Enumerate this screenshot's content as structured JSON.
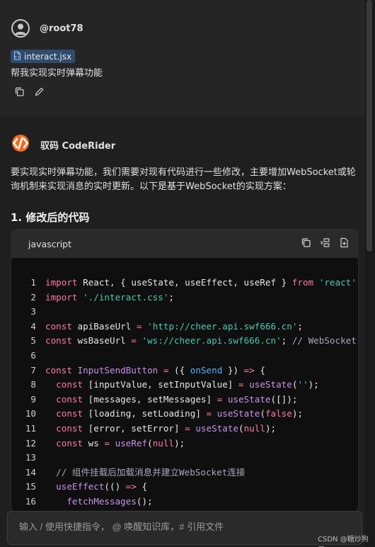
{
  "user_message": {
    "username": "@root78",
    "file_chip": "interact.jsx",
    "text": "帮我实现实时弹幕功能",
    "actions": [
      "copy-icon",
      "edit-icon"
    ]
  },
  "assistant": {
    "name": "驭码 CodeRider",
    "intro": "要实现实时弹幕功能，我们需要对现有代码进行一些修改，主要增加WebSocket或轮询机制来实现消息的实时更新。以下是基于WebSocket的实现方案：",
    "section_heading": "1. 修改后的代码",
    "code_block": {
      "language": "javascript",
      "tools": [
        "copy-icon",
        "insert-icon",
        "new-file-icon"
      ],
      "lines": [
        {
          "n": "1",
          "tokens": [
            [
              "kw",
              "import"
            ],
            [
              "pl",
              " React, { useState, useEffect, useRef } "
            ],
            [
              "kw",
              "from"
            ],
            [
              "pl",
              " "
            ],
            [
              "str",
              "'react'"
            ]
          ]
        },
        {
          "n": "2",
          "tokens": [
            [
              "kw",
              "import"
            ],
            [
              "pl",
              " "
            ],
            [
              "str",
              "'./interact.css'"
            ],
            [
              "pl",
              ";"
            ]
          ]
        },
        {
          "n": "3",
          "tokens": []
        },
        {
          "n": "4",
          "tokens": [
            [
              "kw",
              "const"
            ],
            [
              "pl",
              " apiBaseUrl "
            ],
            [
              "kw",
              "="
            ],
            [
              "pl",
              " "
            ],
            [
              "str",
              "'http://cheer.api.swf666.cn'"
            ],
            [
              "pl",
              ";"
            ]
          ]
        },
        {
          "n": "5",
          "tokens": [
            [
              "kw",
              "const"
            ],
            [
              "pl",
              " wsBaseUrl "
            ],
            [
              "kw",
              "="
            ],
            [
              "pl",
              " "
            ],
            [
              "str",
              "'ws://cheer.api.swf666.cn'"
            ],
            [
              "pl",
              "; "
            ],
            [
              "cm",
              "// WebSocket"
            ]
          ]
        },
        {
          "n": "6",
          "tokens": []
        },
        {
          "n": "7",
          "tokens": [
            [
              "kw",
              "const"
            ],
            [
              "pl",
              " "
            ],
            [
              "fn",
              "InputSendButton"
            ],
            [
              "pl",
              " "
            ],
            [
              "kw",
              "="
            ],
            [
              "pl",
              " ({ "
            ],
            [
              "param",
              "onSend"
            ],
            [
              "pl",
              " }) "
            ],
            [
              "kw",
              "=>"
            ],
            [
              "pl",
              " {"
            ]
          ]
        },
        {
          "n": "8",
          "tokens": [
            [
              "pl",
              "  "
            ],
            [
              "kw",
              "const"
            ],
            [
              "pl",
              " [inputValue, setInputValue] "
            ],
            [
              "kw",
              "="
            ],
            [
              "pl",
              " "
            ],
            [
              "fn",
              "useState"
            ],
            [
              "pl",
              "("
            ],
            [
              "str",
              "''"
            ],
            [
              "pl",
              ");"
            ]
          ]
        },
        {
          "n": "9",
          "tokens": [
            [
              "pl",
              "  "
            ],
            [
              "kw",
              "const"
            ],
            [
              "pl",
              " [messages, setMessages] "
            ],
            [
              "kw",
              "="
            ],
            [
              "pl",
              " "
            ],
            [
              "fn",
              "useState"
            ],
            [
              "pl",
              "([]);"
            ]
          ]
        },
        {
          "n": "10",
          "tokens": [
            [
              "pl",
              "  "
            ],
            [
              "kw",
              "const"
            ],
            [
              "pl",
              " [loading, setLoading] "
            ],
            [
              "kw",
              "="
            ],
            [
              "pl",
              " "
            ],
            [
              "fn",
              "useState"
            ],
            [
              "pl",
              "("
            ],
            [
              "bool",
              "false"
            ],
            [
              "pl",
              ");"
            ]
          ]
        },
        {
          "n": "11",
          "tokens": [
            [
              "pl",
              "  "
            ],
            [
              "kw",
              "const"
            ],
            [
              "pl",
              " [error, setError] "
            ],
            [
              "kw",
              "="
            ],
            [
              "pl",
              " "
            ],
            [
              "fn",
              "useState"
            ],
            [
              "pl",
              "("
            ],
            [
              "bool",
              "null"
            ],
            [
              "pl",
              ");"
            ]
          ]
        },
        {
          "n": "12",
          "tokens": [
            [
              "pl",
              "  "
            ],
            [
              "kw",
              "const"
            ],
            [
              "pl",
              " ws "
            ],
            [
              "kw",
              "="
            ],
            [
              "pl",
              " "
            ],
            [
              "fn",
              "useRef"
            ],
            [
              "pl",
              "("
            ],
            [
              "bool",
              "null"
            ],
            [
              "pl",
              ");"
            ]
          ]
        },
        {
          "n": "13",
          "tokens": []
        },
        {
          "n": "14",
          "tokens": [
            [
              "pl",
              "  "
            ],
            [
              "cm",
              "// 组件挂载后加载消息并建立WebSocket连接"
            ]
          ]
        },
        {
          "n": "15",
          "tokens": [
            [
              "pl",
              "  "
            ],
            [
              "fn",
              "useEffect"
            ],
            [
              "pl",
              "(() "
            ],
            [
              "kw",
              "=>"
            ],
            [
              "pl",
              " {"
            ]
          ]
        },
        {
          "n": "16",
          "tokens": [
            [
              "pl",
              "    "
            ],
            [
              "fn",
              "fetchMessages"
            ],
            [
              "pl",
              "();"
            ]
          ]
        }
      ]
    }
  },
  "input": {
    "placeholder": "输入 / 使用快捷指令， @ 唤醒知识库，# 引用文件"
  },
  "watermark": "CSDN @糖炒狗子"
}
